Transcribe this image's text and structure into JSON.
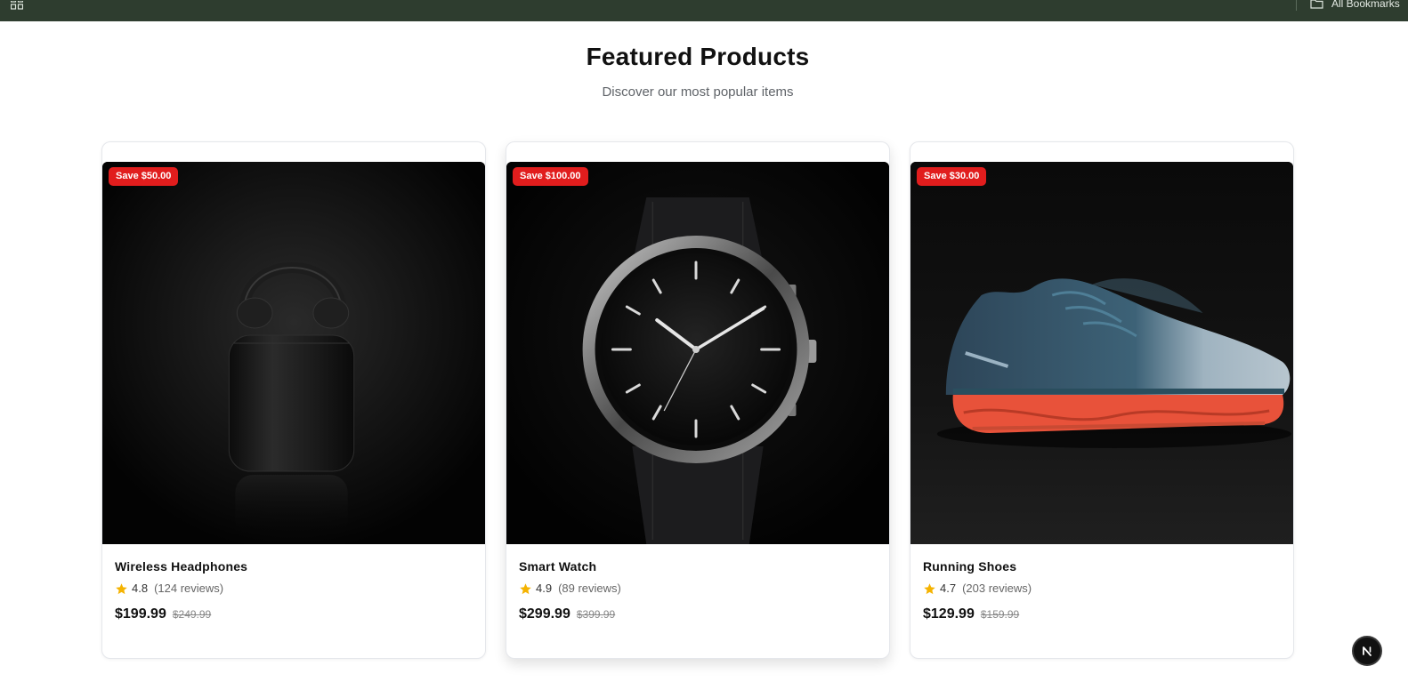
{
  "bookmarks_bar": {
    "all_bookmarks_label": "All Bookmarks",
    "apps_icon": "apps-grid-icon",
    "folder_icon": "folder-icon"
  },
  "section": {
    "title": "Featured Products",
    "subtitle": "Discover our most popular items"
  },
  "products": [
    {
      "badge": "Save $50.00",
      "name": "Wireless Headphones",
      "rating": "4.8",
      "reviews": "(124 reviews)",
      "price": "$199.99",
      "original_price": "$249.99",
      "image_subject": "earbuds-case"
    },
    {
      "badge": "Save $100.00",
      "name": "Smart Watch",
      "rating": "4.9",
      "reviews": "(89 reviews)",
      "price": "$299.99",
      "original_price": "$399.99",
      "image_subject": "wrist-watch"
    },
    {
      "badge": "Save $30.00",
      "name": "Running Shoes",
      "rating": "4.7",
      "reviews": "(203 reviews)",
      "price": "$129.99",
      "original_price": "$159.99",
      "image_subject": "running-shoe"
    }
  ],
  "colors": {
    "topbar": "#2e3d2f",
    "badge": "#e11d1d",
    "star": "#f5b301"
  },
  "floating_button": {
    "icon": "next-logo-icon"
  }
}
